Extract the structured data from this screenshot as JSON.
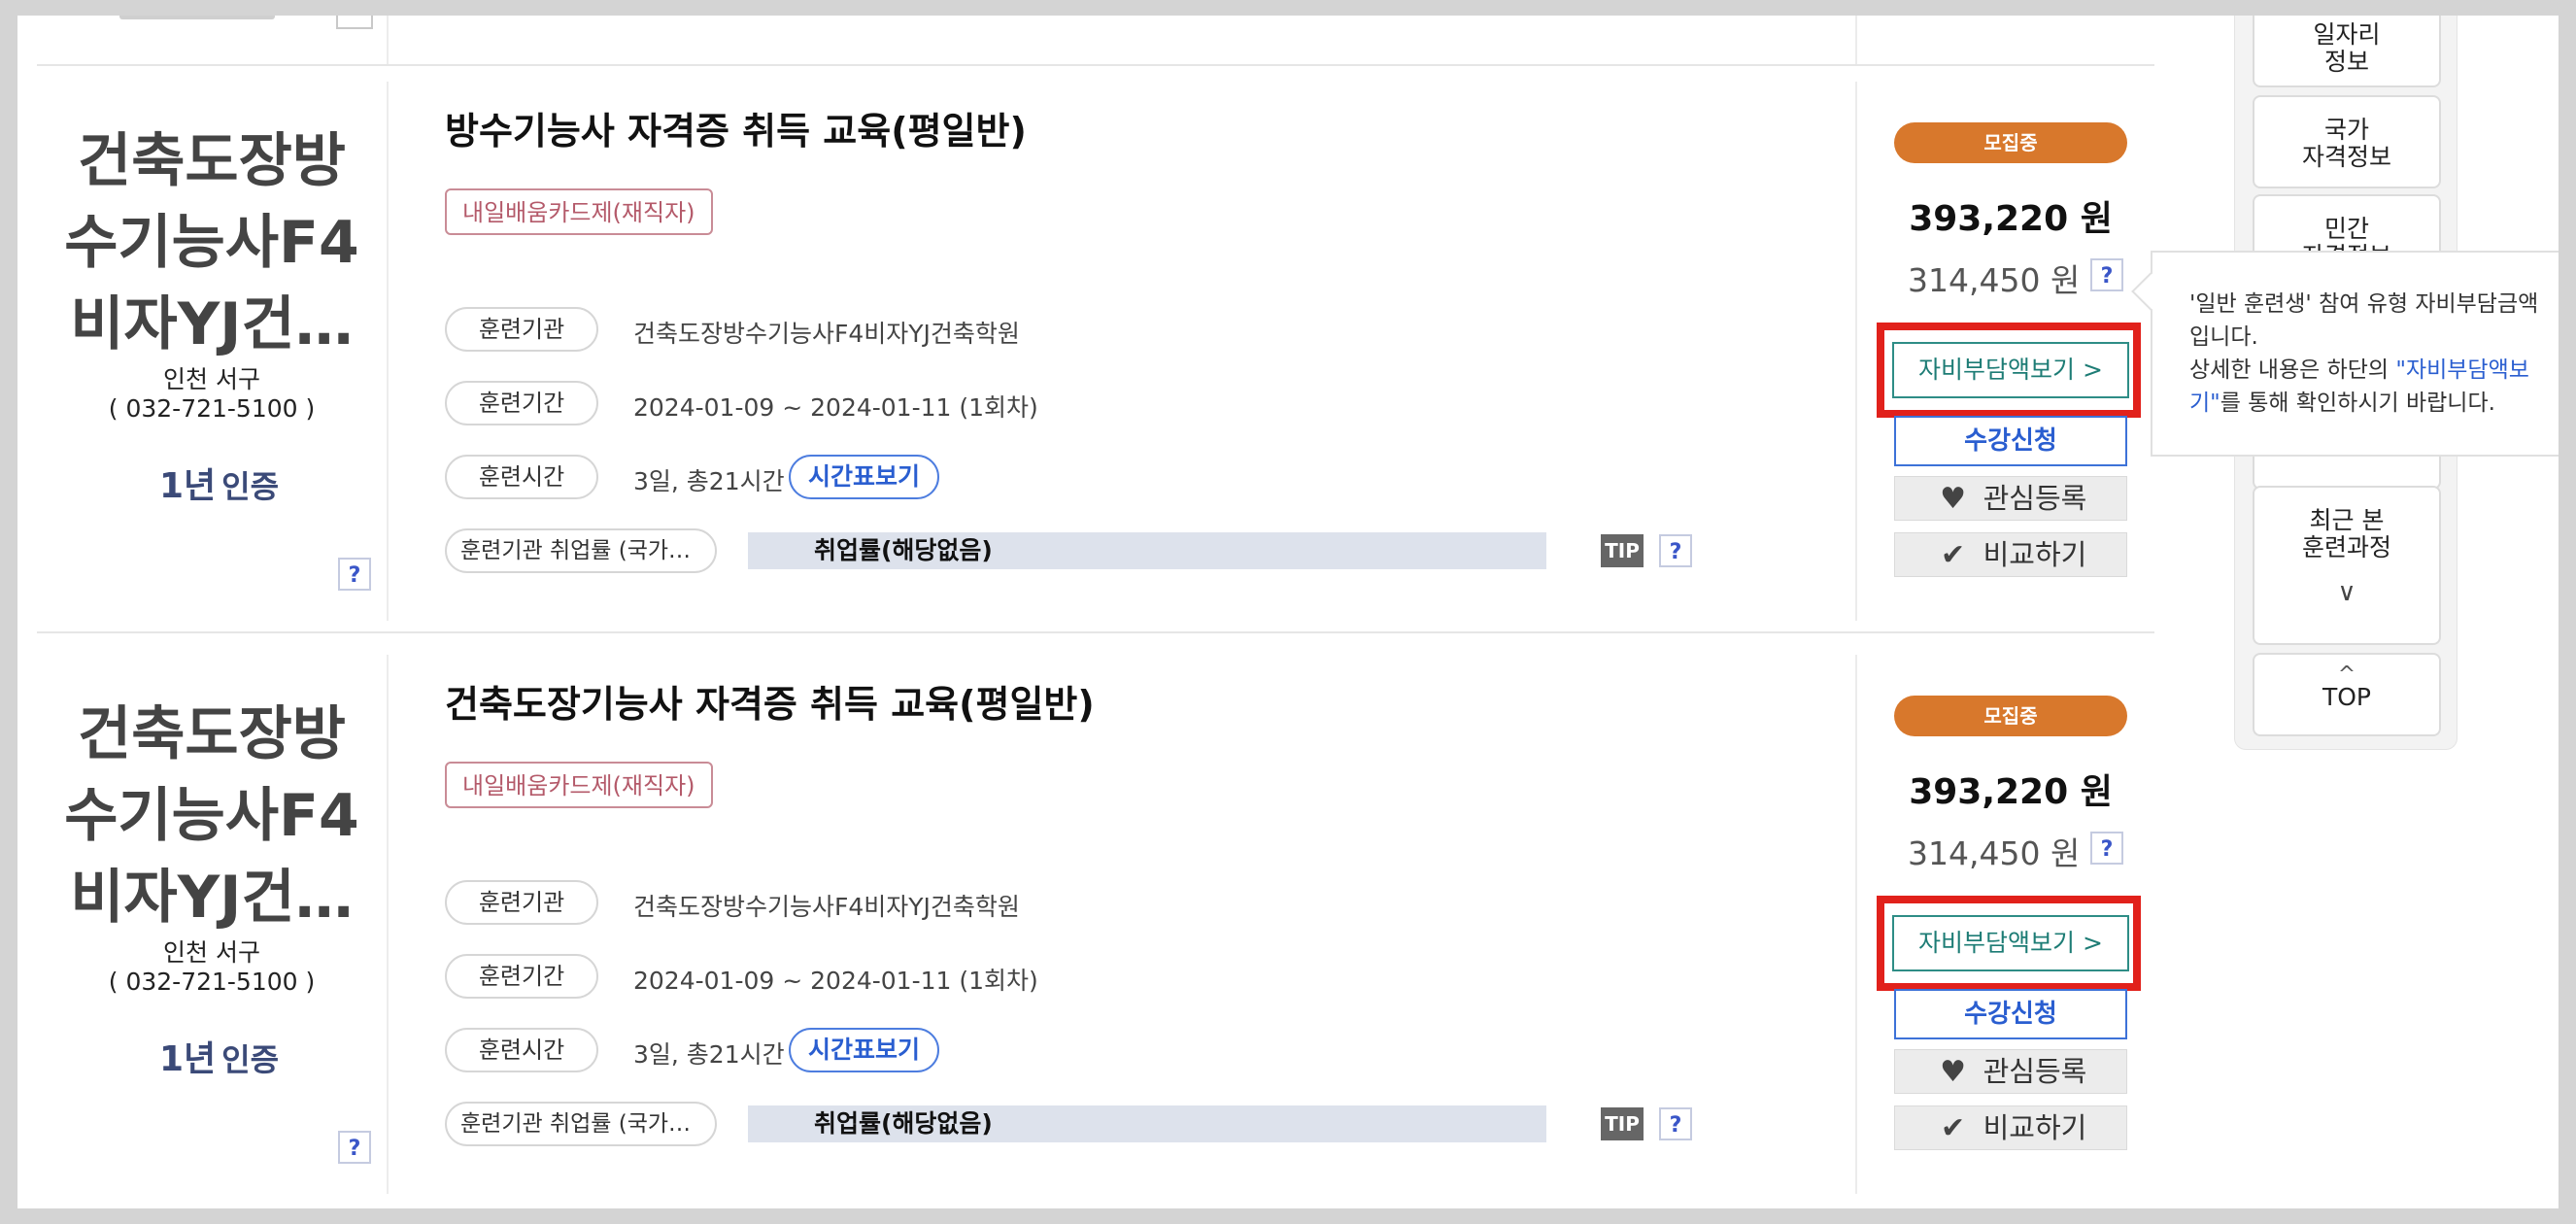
{
  "courses": [
    {
      "institution": [
        "건축도장방",
        "수기능사F4",
        "비자YJ건…"
      ],
      "region": "인천 서구",
      "phone": "( 032-721-5100 )",
      "cert_label": "인증",
      "cert_year": "1년",
      "title": "방수기능사 자격증 취득 교육(평일반)",
      "card_badge": "내일배움카드제(재직자)",
      "rows": {
        "org_label": "훈련기관",
        "org_value": "건축도장방수기능사F4비자YJ건축학원",
        "period_label": "훈련기간",
        "period_value": "2024-01-09 ~ 2024-01-11 (1회차)",
        "time_label": "훈련시간",
        "time_value": "3일, 총21시간",
        "timetable_button": "시간표보기",
        "emp_label": "훈련기관 취업률 (국가…",
        "emp_value": "취업률(해당없음)",
        "tip": "TIP"
      },
      "status": "모집중",
      "price": "393,220 원",
      "self_price": "314,450 원",
      "selfpay_button": "자비부담액보기 >",
      "apply_button": "수강신청",
      "wish_button": "관심등록",
      "compare_button": "비교하기"
    },
    {
      "institution": [
        "건축도장방",
        "수기능사F4",
        "비자YJ건…"
      ],
      "region": "인천 서구",
      "phone": "( 032-721-5100 )",
      "cert_label": "인증",
      "cert_year": "1년",
      "title": "건축도장기능사 자격증 취득 교육(평일반)",
      "card_badge": "내일배움카드제(재직자)",
      "rows": {
        "org_label": "훈련기관",
        "org_value": "건축도장방수기능사F4비자YJ건축학원",
        "period_label": "훈련기간",
        "period_value": "2024-01-09 ~ 2024-01-11 (1회차)",
        "time_label": "훈련시간",
        "time_value": "3일, 총21시간",
        "timetable_button": "시간표보기",
        "emp_label": "훈련기관 취업률 (국가…",
        "emp_value": "취업률(해당없음)",
        "tip": "TIP"
      },
      "status": "모집중",
      "price": "393,220 원",
      "self_price": "314,450 원",
      "selfpay_button": "자비부담액보기 >",
      "apply_button": "수강신청",
      "wish_button": "관심등록",
      "compare_button": "비교하기"
    }
  ],
  "help_mark": "?",
  "quick_menu": {
    "job_info": [
      "일자리",
      "정보"
    ],
    "national_cert": [
      "국가",
      "자격정보"
    ],
    "private_cert": [
      "민간",
      "자격정보"
    ],
    "recent": [
      "최근 본",
      "훈련과정"
    ],
    "top": "TOP"
  },
  "tooltip": {
    "line1": "'일반 훈련생' 참여 유형 자비부담금액 입니다.",
    "line2_pre": "상세한 내용은 하단의 ",
    "line2_link": "\"자비부담액보기\"",
    "line2_post": "를 통해 확인하시기 바랍니다."
  },
  "colors": {
    "status_orange": "#d8782c",
    "highlight_red": "#e1211b",
    "link_blue": "#2a5ed0",
    "selfpay_teal": "#1d7c75"
  },
  "icons": {
    "wish": "heart-icon",
    "compare": "check-icon",
    "recent_toggle": "chevron-down-icon",
    "top": "chevron-up-icon"
  }
}
